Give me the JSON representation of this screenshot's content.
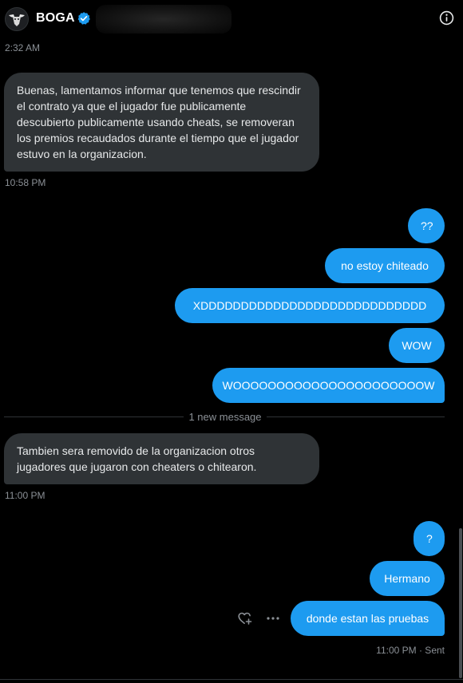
{
  "header": {
    "name": "BOGA"
  },
  "times": {
    "t1": "2:32 AM",
    "t2": "10:58 PM",
    "t3": "11:00 PM",
    "t4": "11:00 PM · Sent"
  },
  "divider": {
    "label": "1 new message"
  },
  "messages": {
    "m1": "Buenas, lamentamos informar que tenemos que rescindir  el contrato ya que el jugador fue publicamente descubierto publicamente usando cheats, se removeran los  premios recaudados durante el tiempo que el jugador estuvo en la organizacion.",
    "m2": "??",
    "m3": "no estoy chiteado",
    "m4": "XDDDDDDDDDDDDDDDDDDDDDDDDDDDD",
    "m5": "WOW",
    "m6": "WOOOOOOOOOOOOOOOOOOOOOOW",
    "m7": "Tambien sera removido de la organizacion otros jugadores que jugaron con cheaters o chitearon.",
    "m8": "?",
    "m9": "Hermano",
    "m10": "donde estan las pruebas"
  },
  "colors": {
    "background": "#000000",
    "incoming_bubble": "#2f3336",
    "outgoing_bubble": "#1d9bf0",
    "verified_badge": "#1d9bf0",
    "muted_text": "#8b9096"
  },
  "icons": {
    "avatar": "bull-logo",
    "verified": "verified-badge-icon",
    "info": "info-icon",
    "react": "heart-plus-icon",
    "more": "more-icon"
  }
}
